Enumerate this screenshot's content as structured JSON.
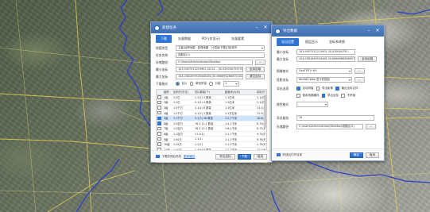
{
  "colors": {
    "accent": "#2f75d6",
    "title_bar": "#4a78bb",
    "border_line": "#1f3fb5",
    "road_line": "#e8d24a"
  },
  "left_dialog": {
    "title": "新建任务",
    "tabs": [
      "下载",
      "矢量数据",
      "POI (仅显示)",
      "矢量要素"
    ],
    "name_label": "地图类型",
    "name_value": "卫星|谷歌地图 · 影像地图 · 20层级下载区域|城市",
    "task_label": "任务名称",
    "task_value": "成都区(2)",
    "save_label": "存储路径",
    "save_value": "C:\\Users\\Administrator\\Desktop",
    "save_btn": "...",
    "min_label": "最小坐标",
    "min_value": "103.9457521215901,30.52...,30.5290047597517061",
    "min_btn": "坐标拾取",
    "max_label": "最大坐标",
    "max_value": "104.0581699535408054,30.6666962666752012",
    "max_btn": "清空坐标",
    "dl_label": "下载格式",
    "dl_opt1": "瓦片",
    "dl_opt2": "单张拼接",
    "dl_opt3": "分组",
    "dl_sel": "",
    "dl_other": "1",
    "table_headers": [
      "级别",
      "比例尺(中文)",
      "切片数量(个)",
      "距离米(大约)",
      "实际尺寸(约)"
    ],
    "rows": [
      {
        "level": "1级",
        "scale": "1:2亿",
        "tiles": "1.1(1) 3 数量",
        "dist": "1.1亿米",
        "size": "1.1(约)"
      },
      {
        "level": "2级",
        "scale": "1:1亿",
        "tiles": "2.1(1) 4 数量",
        "dist": "1.2亿米",
        "size": "2.1(约)"
      },
      {
        "level": "3级",
        "scale": "1:5千万",
        "tiles": "3.1(2) 8 数量",
        "dist": "1:1亿米",
        "size": "13.1(约)"
      },
      {
        "level": "4级",
        "scale": "1:2千万",
        "tiles": "4.1(2) 3 数量",
        "dist": "1:1万亿米",
        "size": "13.3(约)"
      },
      {
        "level": "5级",
        "scale": "1:1千万",
        "tiles": "5.1(3) 48 数量",
        "dist": "1:2.2千米",
        "size": "16.6(约)"
      },
      {
        "level": "6级",
        "scale": "1:5百万",
        "tiles": "76.3 11.1 数量",
        "dist": "1:4.1千米",
        "size": "8.73(约)"
      },
      {
        "level": "7级",
        "scale": "1:2百万",
        "tiles": "76.3 11.1 数量",
        "dist": "1:8.1千米",
        "size": "8.73(约)"
      },
      {
        "level": "8级",
        "scale": "1:1百万",
        "tiles": "11.1(1)",
        "dist": "1:1.1千米",
        "size": "9.74(约)"
      },
      {
        "level": "9级",
        "scale": "1:50万",
        "tiles": "1.1(1)",
        "dist": "1:1.2千米",
        "size": "9.7K(约)"
      },
      {
        "level": "10级",
        "scale": "1:25万",
        "tiles": "1.1(1)",
        "dist": "1:1.2千米",
        "size": "1.7K(约)"
      },
      {
        "level": "11级",
        "scale": "1:10万",
        "tiles": "1.4(6) 8 数量",
        "dist": "1:2.2千米",
        "size": "13.1(约)"
      },
      {
        "level": "12级",
        "scale": "1:5万",
        "tiles": "33.1(8)",
        "dist": "1:4.4千米",
        "size": "13.8(约)"
      },
      {
        "level": "13级",
        "scale": "1:2.5万",
        "tiles": "1.1(1) 数量",
        "dist": "1:1.2千米",
        "size": "6.3(约)"
      }
    ],
    "footer_check": "下载完成后关机",
    "footer_link": "更新缓存",
    "btn_export": "导出坐标",
    "btn_download": "下载",
    "btn_cancel": "取消"
  },
  "right_dialog": {
    "title": "导出数据",
    "tabs": [
      "导出设置",
      "图层显示",
      "坐标系转换"
    ],
    "min_label": "最小坐标",
    "min_value": "103.9457521215901,30.529004755...",
    "max_label": "最大坐标",
    "max_value": "104.0581699535408,30.66669862666576",
    "max_btn": "坐标拾取",
    "format_label": "图像格式",
    "format_value": "GeoTIFF(*.tif)",
    "format_btn": "...",
    "projection_label": "投影坐标",
    "projection_value": "WGS84 Web 墨卡托投影",
    "projection_btn": "...",
    "opt_label": "导出选项",
    "opt1": "自动拼接",
    "opt2": "导出影像",
    "opt3": "输出坐标文件",
    "opt4": "使用地图缓存",
    "opt5": "导出坐标",
    "opt6": "不拼接",
    "color_label": "颜色格式",
    "color_value": "",
    "level_label": "导出级别",
    "level_value": "19",
    "path_label": "存储路径",
    "path_value": "C:\\Users\\Administrator\\Desktop\\成都区(2)",
    "path_btn": "...",
    "footer_check": "完成后打开目录",
    "btn_ok": "确定",
    "btn_cancel": "取消"
  }
}
